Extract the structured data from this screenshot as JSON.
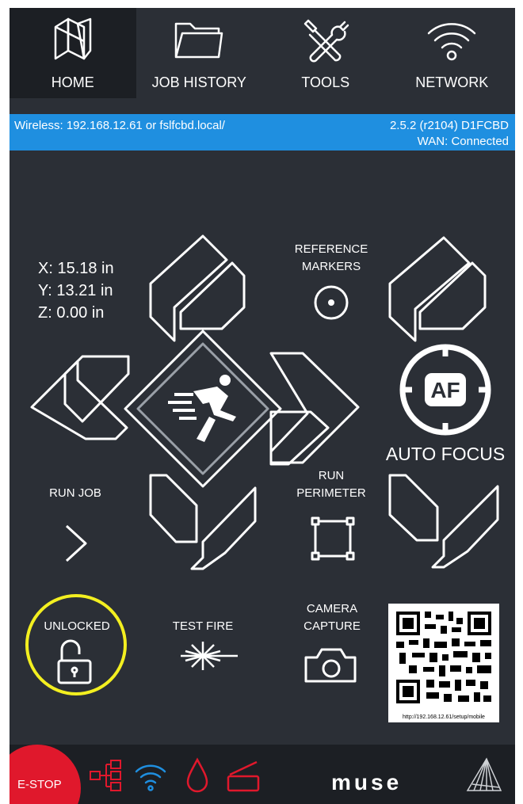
{
  "nav": {
    "tabs": [
      {
        "label": "HOME",
        "icon": "machine-logo-icon",
        "active": true
      },
      {
        "label": "JOB HISTORY",
        "icon": "folder-icon",
        "active": false
      },
      {
        "label": "TOOLS",
        "icon": "tools-icon",
        "active": false
      },
      {
        "label": "NETWORK",
        "icon": "wifi-icon",
        "active": false
      }
    ]
  },
  "status": {
    "connection": "Wireless: 192.168.12.61  or fslfcbd.local/",
    "version": "2.5.2 (r2104)  D1FCBD",
    "wan": "WAN: Connected"
  },
  "position": {
    "x": "X: 15.18 in",
    "y": "Y: 13.21 in",
    "z": "Z: 0.00 in"
  },
  "controls": {
    "reference_markers": "REFERENCE MARKERS",
    "auto_focus": "AUTO FOCUS",
    "af_badge": "AF",
    "run_job": "RUN JOB",
    "run_perimeter": "RUN PERIMETER",
    "unlocked": "UNLOCKED",
    "test_fire": "TEST FIRE",
    "camera_capture": "CAMERA CAPTURE",
    "qr_caption": "http://192.168.12.61/setup/mobile"
  },
  "bottom": {
    "estop": "E-STOP",
    "brand": "muse",
    "icons": [
      "network-tree-icon",
      "wifi-icon",
      "water-drop-icon",
      "scanner-lid-icon",
      "pyramid-logo-icon"
    ]
  },
  "colors": {
    "background": "#2b2f36",
    "status_bar": "#1f8fe0",
    "estop": "#e0182c",
    "highlight_ring": "#f3ef20",
    "bottom_icons": "#e0182c",
    "wifi_icon": "#1f8fe0"
  }
}
